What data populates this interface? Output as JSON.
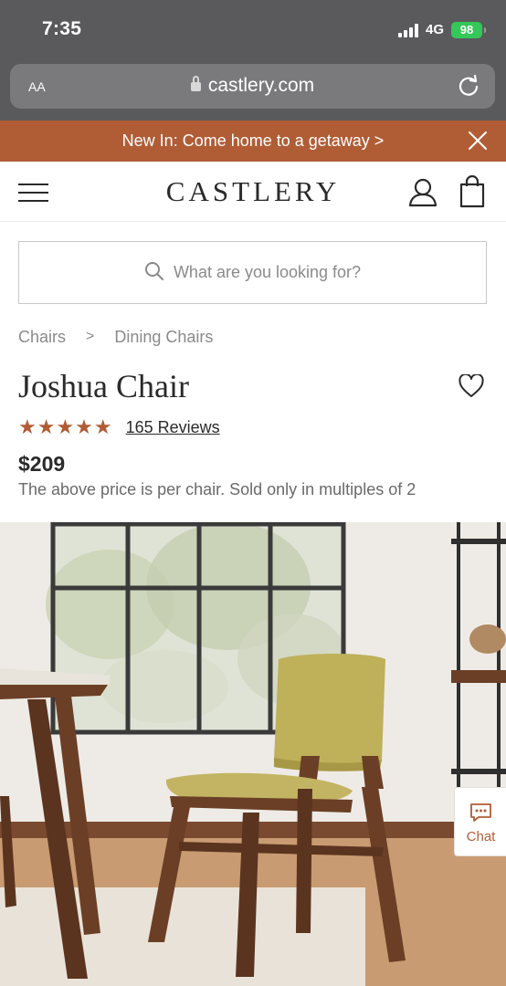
{
  "status_bar": {
    "time": "7:35",
    "network": "4G",
    "battery": "98"
  },
  "browser": {
    "text_size_label": "AA",
    "url": "castlery.com"
  },
  "promo": {
    "text": "New In: Come home to a getaway >"
  },
  "header": {
    "logo": "CASTLERY"
  },
  "search": {
    "placeholder": "What are you looking for?"
  },
  "breadcrumb": {
    "items": [
      "Chairs",
      "Dining Chairs"
    ],
    "separator": ">"
  },
  "product": {
    "name": "Joshua Chair",
    "rating": 5,
    "stars": "★★★★★",
    "reviews": "165 Reviews",
    "price": "$209",
    "price_note": "The above price is per chair. Sold only in multiples of 2"
  },
  "chat": {
    "label": "Chat"
  },
  "colors": {
    "accent": "#b05d36",
    "chrome": "#5a5a5c",
    "text": "#2a2a2a",
    "muted": "#8a8a8a"
  }
}
